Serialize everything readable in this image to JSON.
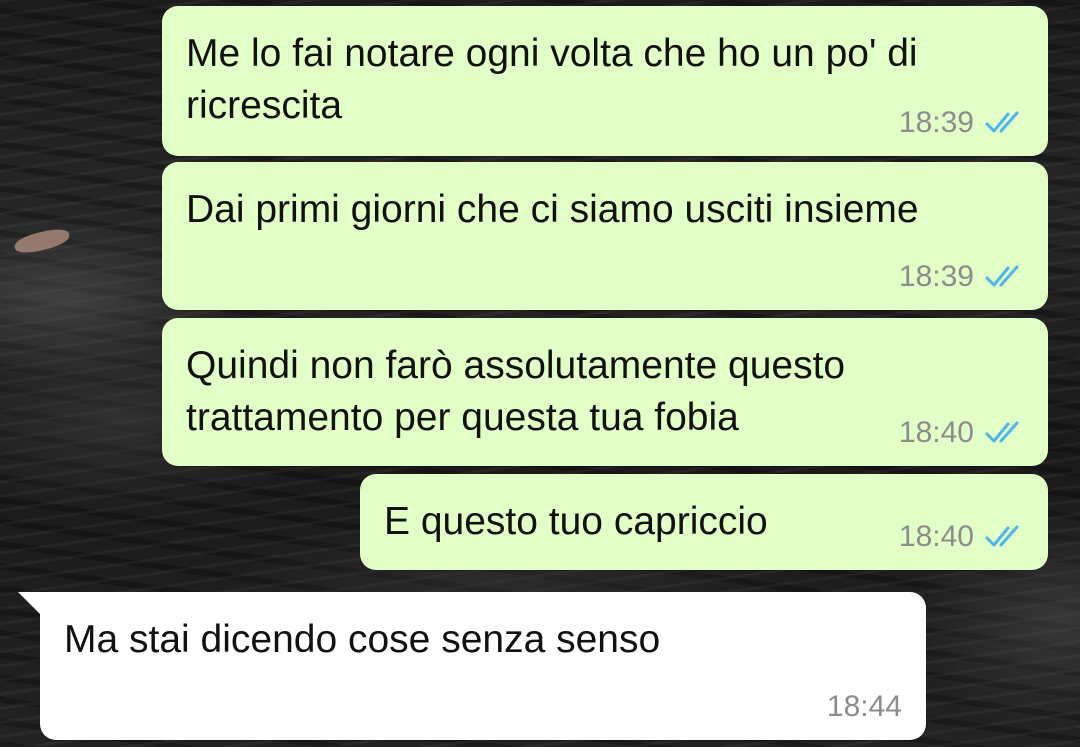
{
  "chat": {
    "messages": [
      {
        "direction": "outgoing",
        "text": "Me lo fai notare ogni volta che ho un po' di\nricrescita",
        "time": "18:39",
        "status": "read-double-tick"
      },
      {
        "direction": "outgoing",
        "text": "Dai primi giorni che ci siamo usciti insieme",
        "time": "18:39",
        "status": "read-double-tick"
      },
      {
        "direction": "outgoing",
        "text": "Quindi non farò assolutamente questo\ntrattamento per questa tua fobia",
        "time": "18:40",
        "status": "read-double-tick"
      },
      {
        "direction": "outgoing",
        "text": "E questo tuo capriccio",
        "time": "18:40",
        "status": "read-double-tick"
      },
      {
        "direction": "incoming",
        "text": "Ma stai dicendo cose senza senso",
        "time": "18:44"
      }
    ]
  },
  "colors": {
    "outgoing_bubble": "#e2ffc7",
    "incoming_bubble": "#ffffff",
    "read_tick": "#4fb6ec",
    "time_text": "#8c8c8c"
  }
}
